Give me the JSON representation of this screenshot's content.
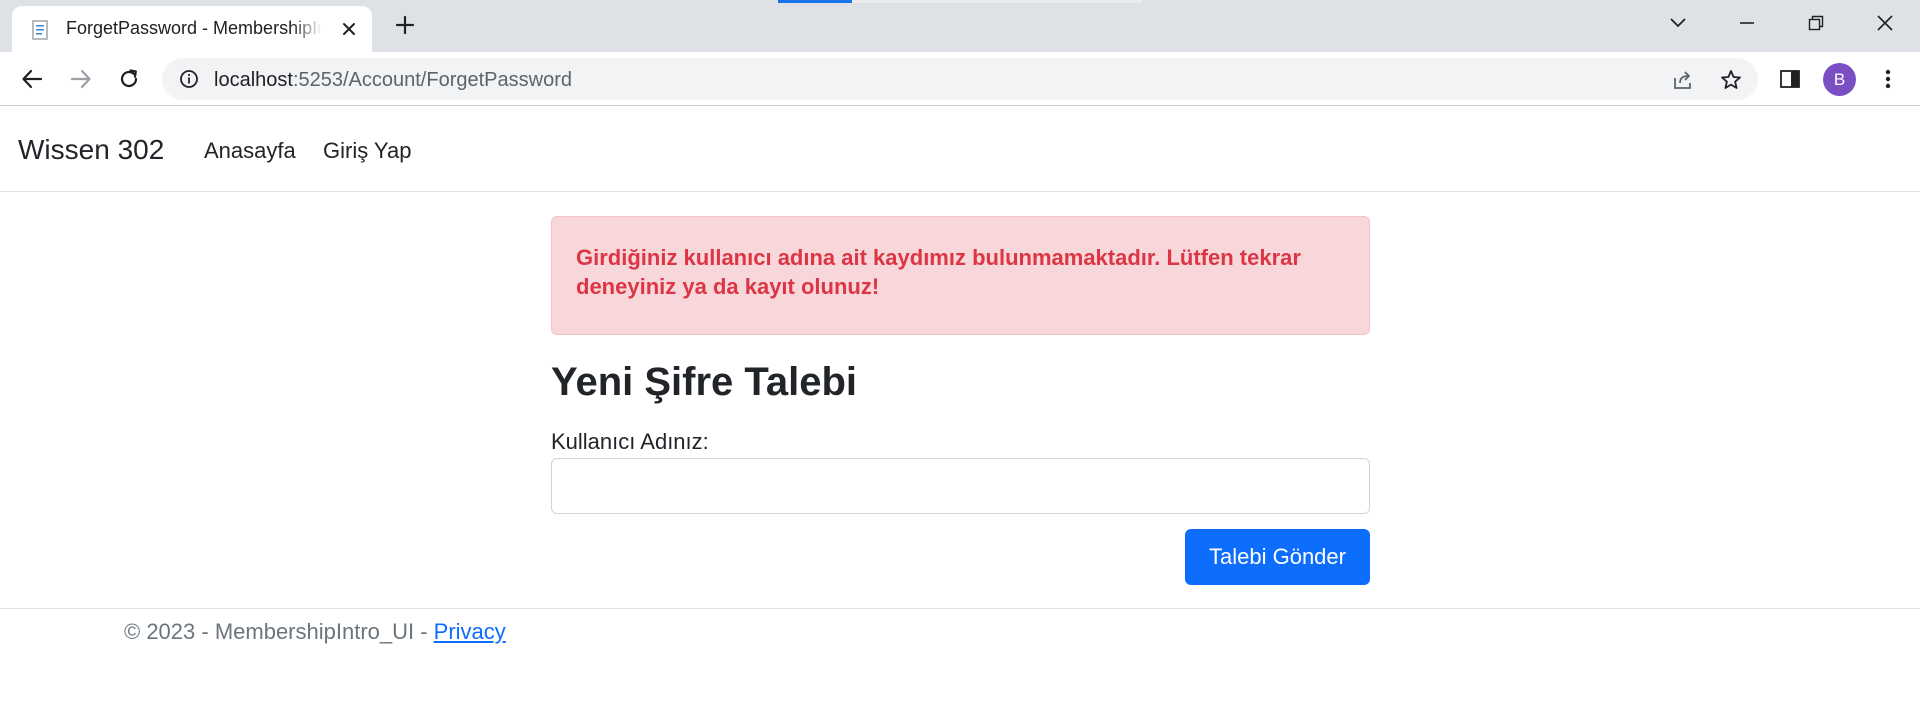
{
  "browser": {
    "tab_title": "ForgetPassword - MembershipIntro_UI",
    "url_host": "localhost",
    "url_path": ":5253/Account/ForgetPassword",
    "profile_initial": "B",
    "accent_color": "#1a73e8",
    "profile_color": "#7b4fc4",
    "icons": [
      "page-favicon-icon",
      "close-icon",
      "plus-icon",
      "chevron-down-icon",
      "minimize-icon",
      "restore-icon",
      "close-window-icon",
      "back-arrow-icon",
      "forward-arrow-icon",
      "reload-icon",
      "info-icon",
      "share-icon",
      "star-icon",
      "side-panel-icon",
      "more-vert-icon"
    ]
  },
  "navbar": {
    "brand": "Wissen 302",
    "links": [
      "Anasayfa",
      "Giriş Yap"
    ]
  },
  "alert": {
    "message": "Girdiğiniz kullanıcı adına ait kaydımız bulunmamaktadır. Lütfen tekrar deneyiniz ya da kayıt olunuz!",
    "text_color": "#dc3545",
    "background_color": "#f8d7da"
  },
  "form": {
    "title": "Yeni Şifre Talebi",
    "username_label": "Kullanıcı Adınız:",
    "username_value": "",
    "submit_label": "Talebi Gönder",
    "button_color": "#0d6efd"
  },
  "footer": {
    "text": "© 2023 - MembershipIntro_UI - ",
    "privacy_link": "Privacy"
  }
}
